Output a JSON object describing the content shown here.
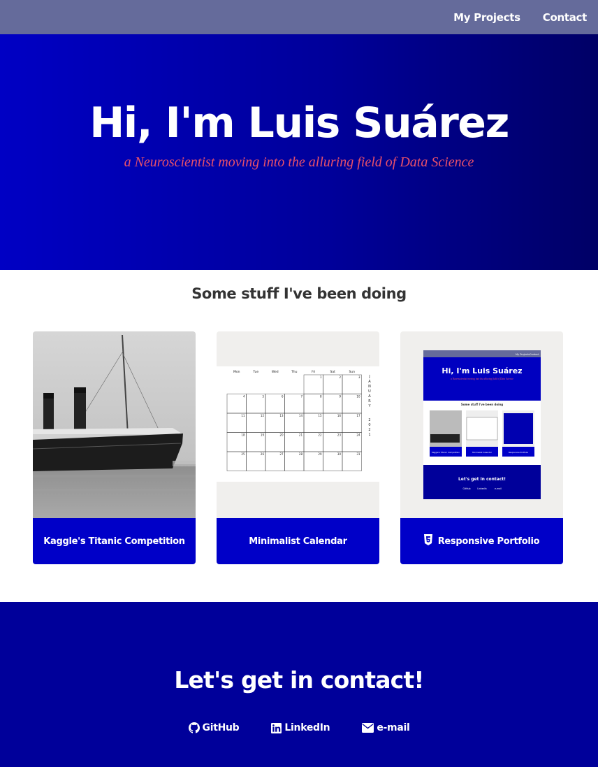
{
  "nav": {
    "items": [
      "My Projects",
      "Contact"
    ]
  },
  "hero": {
    "title": "Hi, I'm Luis Suárez",
    "subtitle": "a Neuroscientist moving into the alluring field of Data Science"
  },
  "projects": {
    "heading": "Some stuff I've been doing",
    "items": [
      {
        "label": "Kaggle's Titanic Competition",
        "icon": "ship-photo"
      },
      {
        "label": "Minimalist Calendar",
        "icon": "calendar-preview"
      },
      {
        "label": "Responsive Portfolio",
        "icon": "html5-icon"
      }
    ],
    "calendar": {
      "weekdays": [
        "Mon",
        "Tue",
        "Wed",
        "Thu",
        "Fri",
        "Sat",
        "Sun"
      ],
      "month": "JANUARY",
      "year": "2021"
    },
    "mini_portfolio": {
      "nav": [
        "My Projects",
        "Contact"
      ],
      "title": "Hi, I'm Luis Suárez",
      "subtitle": "a Neuroscientist moving into the alluring field of Data Science",
      "heading": "Some stuff I've been doing",
      "cards": [
        "Kaggle's Titanic Competition",
        "Minimalist Calendar",
        "Responsive Portfolio"
      ],
      "contact": "Let's get in contact!",
      "links": [
        "GitHub",
        "LinkedIn",
        "e-mail"
      ]
    }
  },
  "contact": {
    "heading": "Let's get in contact!",
    "links": [
      {
        "label": "GitHub",
        "icon": "github-icon"
      },
      {
        "label": "LinkedIn",
        "icon": "linkedin-icon"
      },
      {
        "label": "e-mail",
        "icon": "envelope-icon"
      }
    ]
  },
  "colors": {
    "nav": "#656b9b",
    "hero_start": "#0000c4",
    "hero_end": "#000066",
    "accent_red": "#e8506a",
    "card_label": "#0000c8",
    "contact": "#00009a"
  }
}
